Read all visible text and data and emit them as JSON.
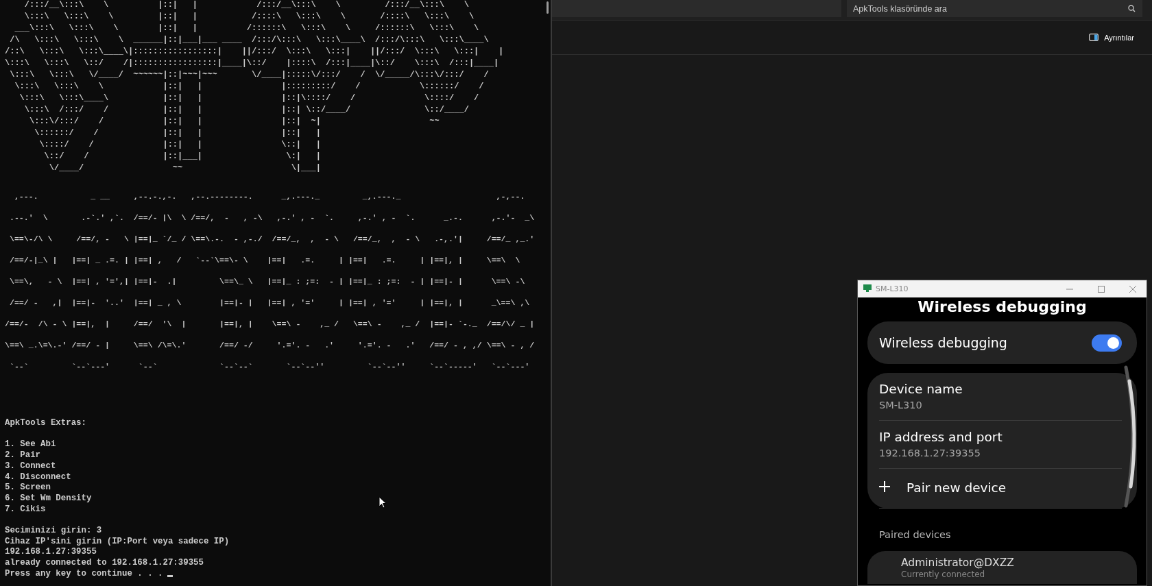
{
  "terminal": {
    "banner_lines": [
      "    /:::/__\\:::\\    \\          |::|   |            /:::/__\\:::\\    \\         /:::/__\\:::\\    \\",
      "    \\:::\\   \\:::\\    \\         |::|   |           /::::\\   \\:::\\    \\       /::::\\   \\:::\\    \\",
      "  ___\\:::\\   \\:::\\    \\        |::|   |          /::::::\\   \\:::\\    \\     /::::::\\   \\:::\\    \\",
      " /\\   \\:::\\   \\:::\\    \\  ______|::|___|___ ____  /:::/\\:::\\   \\:::\\____\\  /:::/\\:::\\   \\:::\\____\\",
      "/::\\   \\:::\\   \\:::\\____\\|:::::::::::::::::|    ||/:::/  \\:::\\   \\:::|    ||/:::/  \\:::\\   \\:::|    |",
      "\\:::\\   \\:::\\   \\::/    /|:::::::::::::::::|____|\\::/    |::::\\  /:::|____|\\::/    \\:::\\  /:::|____|",
      " \\:::\\   \\:::\\   \\/____/  ~~~~~~|::|~~~|~~~       \\/____|:::::\\/:::/    /  \\/_____/\\:::\\/:::/    /",
      "  \\:::\\   \\:::\\    \\            |::|   |                |:::::::::/    /            \\::::::/    /",
      "   \\:::\\   \\:::\\____\\           |::|   |                |::|\\::::/    /              \\::::/    /",
      "    \\:::\\  /:::/    /           |::|   |                |::| \\::/____/               \\::/____/",
      "     \\:::\\/:::/    /            |::|   |                |::|  ~|                      ~~",
      "      \\::::::/    /             |::|   |                |::|   |",
      "       \\::::/    /              |::|   |                \\::|   |",
      "        \\::/    /               |::|___|                 \\:|   |",
      "         \\/____/                  ~~                      \\|___|"
    ],
    "title_lines": [
      "  ,---.           _ __     ,--.-.,-.   ,--.--------.      _,.---._         _,.---._                    ,-,--.",
      " .--.'  \\       .-`.' ,`.  /==/- |\\  \\ /==/,  -   , -\\   ,-.' , -  `.     ,-.' , -  `.      _.-.      ,-.'-  _\\",
      " \\==\\-/\\ \\     /==/, -   \\ |==|_ `/_ / \\==\\.-.  - ,-./  /==/_,  ,  - \\   /==/_,  ,  - \\   .-,.'|     /==/_ ,_.'",
      " /==/-|_\\ |   |==| _ .=. | |==| ,   /   `--`\\==\\- \\    |==|   .=.     | |==|   .=.     | |==|, |     \\==\\  \\",
      " \\==\\,   - \\  |==| , '=',| |==|-  .|         \\==\\_ \\   |==|_ : ;=:  - | |==|_ : ;=:  - | |==|- |      \\==\\ -\\",
      " /==/ -   ,|  |==|-  '..'  |==| _ , \\        |==|- |   |==| , '='     | |==| , '='     | |==|, |      _\\==\\ ,\\",
      "/==/-  /\\ - \\ |==|,  |     /==/  '\\  |       |==|, |    \\==\\ -    ,_ /   \\==\\ -    ,_ /  |==|- `-._  /==/\\/ _ |",
      "\\==\\ _.\\=\\.-' /==/ - |     \\==\\ /\\=\\.'       /==/ -/     '.='. -   .'     '.='. -   .'   /==/ - , ,/ \\==\\ - , /",
      " `--`         `--`---'      `--`             `--`--`       `--`--''         `--`--''     `--`-----'   `--`---'"
    ],
    "heading": "ApkTools Extras:",
    "menu": [
      "1. See Abi",
      "2. Pair",
      "3. Connect",
      "4. Disconnect",
      "5. Screen",
      "6. Set Wm Density",
      "7. Cikis"
    ],
    "log": [
      "Seciminizi girin: 3",
      "Cihaz IP'sini girin (IP:Port veya sadece IP)",
      "192.168.1.27:39355",
      "already connected to 192.168.1.27:39355",
      "Press any key to continue . . ."
    ]
  },
  "explorer": {
    "search": {
      "placeholder": "ApkTools klasöründe ara"
    },
    "details_button": "Ayrıntılar"
  },
  "phone_window": {
    "title": "SM-L310",
    "page_title": "Wireless debugging",
    "toggle": {
      "label": "Wireless debugging",
      "on": true
    },
    "items": [
      {
        "kind": "info",
        "title": "Device name",
        "value": "SM-L310"
      },
      {
        "kind": "info",
        "title": "IP address and port",
        "value": "192.168.1.27:39355"
      },
      {
        "kind": "action",
        "title": "Pair new device"
      }
    ],
    "section": "Paired devices",
    "paired": [
      {
        "name": "Administrator@DXZZ",
        "status": "Currently connected"
      }
    ]
  }
}
